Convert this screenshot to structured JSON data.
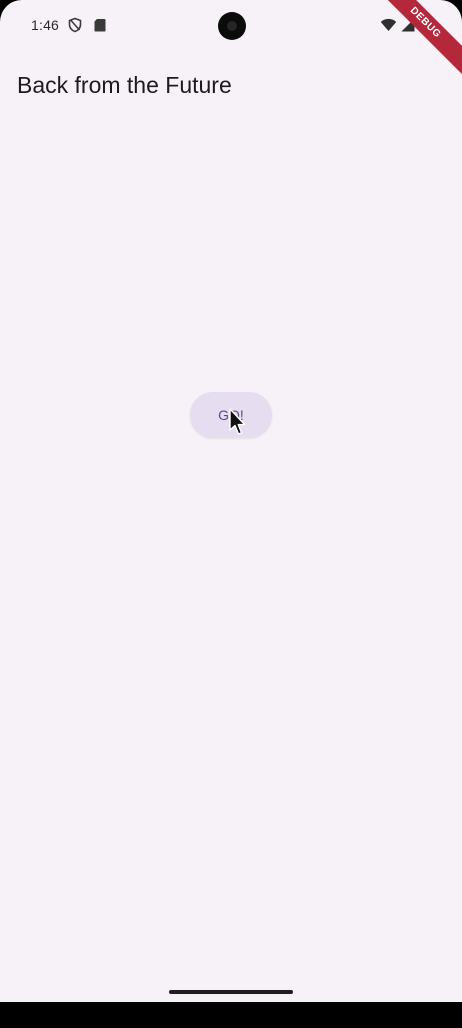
{
  "status_bar": {
    "time": "1:46",
    "left_icons": [
      "vpn-shield-icon",
      "sd-card-icon"
    ],
    "right_icons": [
      "wifi-icon",
      "cell-signal-icon",
      "battery-icon"
    ]
  },
  "debug_banner": {
    "label": "DEBUG"
  },
  "app_bar": {
    "title": "Back from the Future"
  },
  "main": {
    "go_button_label": "GO!"
  },
  "colors": {
    "background": "#f7f1f8",
    "button_fill": "#e6ddf0",
    "button_text": "#5e4a8c",
    "debug_banner": "#b5283c"
  }
}
